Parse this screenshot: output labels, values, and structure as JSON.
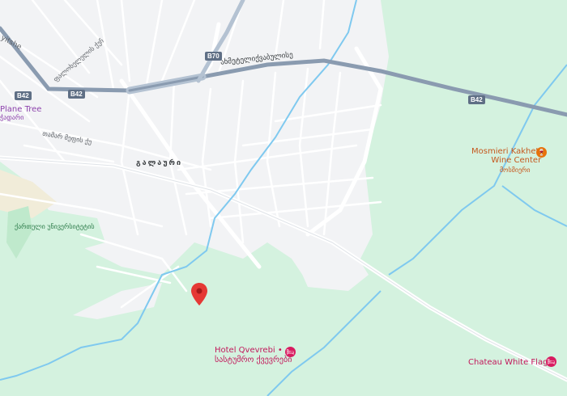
{
  "colors": {
    "land": "#f2f3f5",
    "park": "#d4f2df",
    "road": "#ffffff",
    "highway": "#8a9bb0",
    "water": "#7fc9ef",
    "pin": "#e53935",
    "wine": "#e8710a",
    "hotel": "#d81b60"
  },
  "map": {
    "route_shields": [
      "B70",
      "B42",
      "B42",
      "B42"
    ],
    "highway_label": "ახმეტელიქვაბულისე",
    "street_labels": {
      "top_left": "ფალოხელელის ქუჩ",
      "top_corner": "yitshe",
      "middle_left": "თამარ მეფის ქუ",
      "district": "გალაური",
      "lower_left": "ქართული უნივერსიტეტის"
    },
    "places": {
      "plane_tree": {
        "name": "Plane Tree",
        "sub": "ჭადარი"
      },
      "wine_center": {
        "name_line1": "Mosmieri Kakheti",
        "name_line2": "Wine Center",
        "sub": "მოსმიერი",
        "icon": "wine-glass-icon"
      },
      "hotel_qvevrebi": {
        "name_line1": "Hotel Qvevrebi •",
        "name_line2": "სასტუმრო ქვევრები",
        "icon": "hotel-bed-icon"
      },
      "chateau": {
        "name": "Chateau White Flags",
        "icon": "hotel-bed-icon"
      }
    },
    "pin": {
      "icon": "map-pin-icon"
    }
  }
}
